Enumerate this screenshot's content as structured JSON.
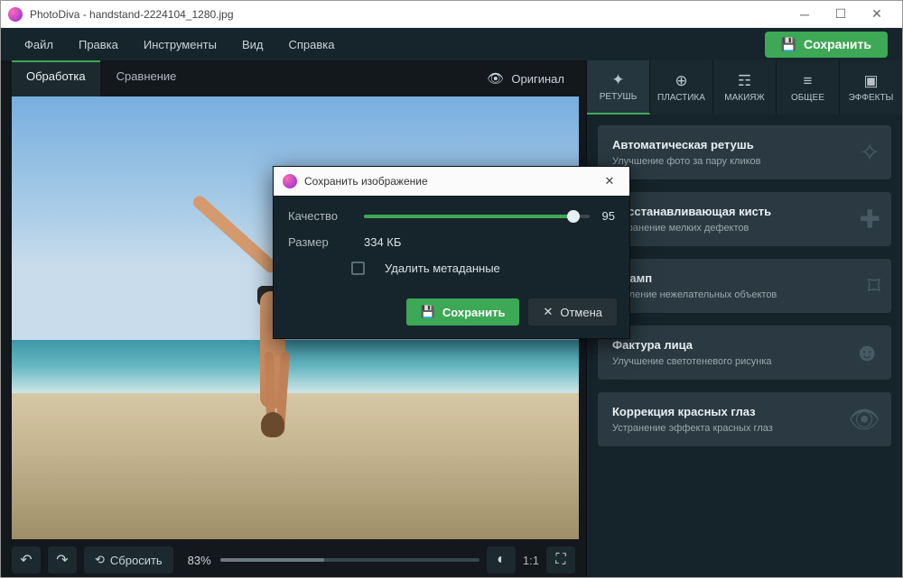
{
  "app": {
    "name": "PhotoDiva",
    "file": "handstand-2224104_1280.jpg"
  },
  "window_title": "PhotoDiva - handstand-2224104_1280.jpg",
  "menu": [
    "Файл",
    "Правка",
    "Инструменты",
    "Вид",
    "Справка"
  ],
  "save_button": "Сохранить",
  "tabs": {
    "process": "Обработка",
    "compare": "Сравнение"
  },
  "original_button": "Оригинал",
  "bottom": {
    "reset": "Сбросить",
    "zoom": "83%",
    "ratio": "1:1"
  },
  "tools": [
    {
      "label": "РЕТУШЬ",
      "icon": "✦"
    },
    {
      "label": "ПЛАСТИКА",
      "icon": "⊕"
    },
    {
      "label": "МАКИЯЖ",
      "icon": "☶"
    },
    {
      "label": "ОБЩЕЕ",
      "icon": "≡"
    },
    {
      "label": "ЭФФЕКТЫ",
      "icon": "▣"
    }
  ],
  "presets": [
    {
      "title": "Автоматическая ретушь",
      "desc": "Улучшение фото за пару кликов",
      "icon": "✧"
    },
    {
      "title": "Восстанавливающая кисть",
      "desc": "Устранение мелких дефектов",
      "icon": "✚"
    },
    {
      "title": "Штамп",
      "desc": "Удаление нежелательных объектов",
      "icon": "⌑"
    },
    {
      "title": "Фактура лица",
      "desc": "Улучшение светотеневого рисунка",
      "icon": "☻"
    },
    {
      "title": "Коррекция красных глаз",
      "desc": "Устранение эффекта красных глаз",
      "icon": "👁"
    }
  ],
  "dialog": {
    "title": "Сохранить изображение",
    "quality_label": "Качество",
    "quality_value": "95",
    "size_label": "Размер",
    "size_value": "334 КБ",
    "delete_metadata": "Удалить метаданные",
    "save": "Сохранить",
    "cancel": "Отмена"
  },
  "colors": {
    "accent": "#3da856",
    "panel": "#16252b",
    "panel_light": "#2b3a42"
  }
}
